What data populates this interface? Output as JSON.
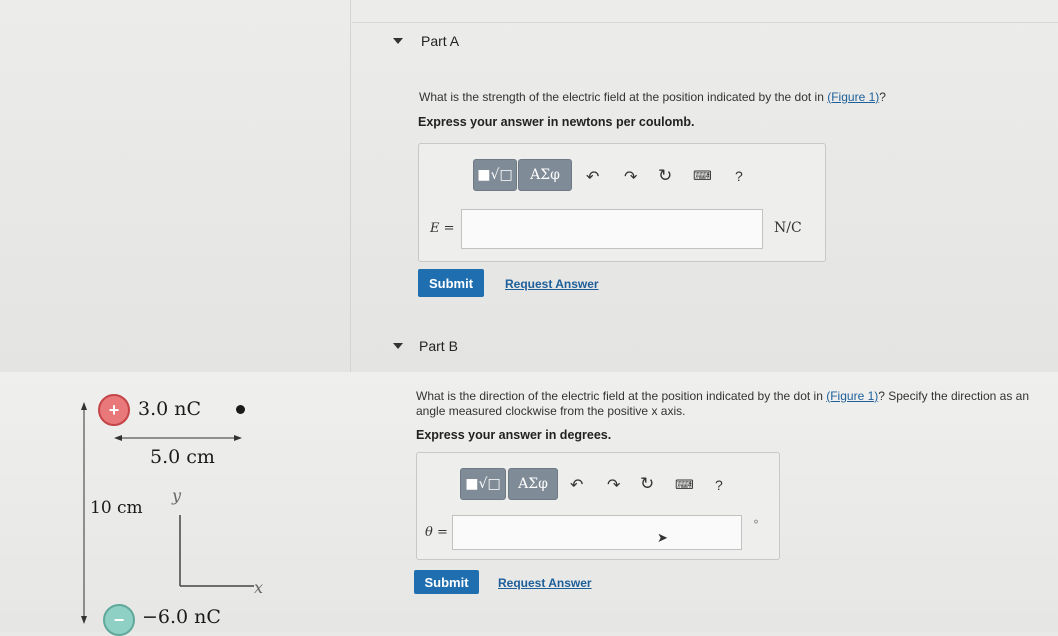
{
  "figure": {
    "positive_charge": {
      "sign": "+",
      "label": "3.0 nC",
      "color": "#e25a5a"
    },
    "negative_charge": {
      "sign": "−",
      "label": "−6.0 nC",
      "color": "#7cc4b8"
    },
    "horizontal_distance": "5.0 cm",
    "vertical_distance": "10 cm",
    "y_axis_label": "y",
    "x_axis_label": "x"
  },
  "part_a": {
    "title": "Part A",
    "question": "What is the strength of the electric field at the position indicated by the dot in ",
    "figure_link": "(Figure 1)",
    "question_end": "?",
    "instruction": "Express your answer in newtons per coulomb.",
    "toolbar": {
      "templates": "■√□",
      "greek": "ΑΣφ",
      "help": "?"
    },
    "variable": "E =",
    "unit": "N/C",
    "submit": "Submit",
    "request_answer": "Request Answer"
  },
  "part_b": {
    "title": "Part B",
    "question_line1": "What is the direction of the electric field at the position indicated by the dot in ",
    "figure_link": "(Figure 1)",
    "question_line1_end": "? Specify the direction as an",
    "question_line2": "angle measured clockwise from the positive x axis.",
    "instruction": "Express your answer in degrees.",
    "toolbar": {
      "templates": "■√□",
      "greek": "ΑΣφ",
      "help": "?"
    },
    "variable": "θ =",
    "unit": "°",
    "submit": "Submit",
    "request_answer": "Request Answer"
  }
}
